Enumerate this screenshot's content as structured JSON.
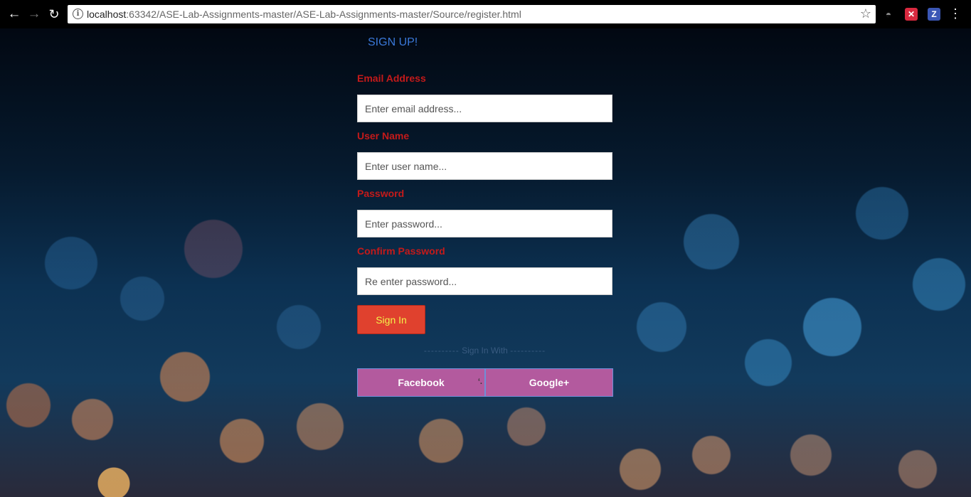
{
  "browser": {
    "url_host": "localhost",
    "url_rest": ":63342/ASE-Lab-Assignments-master/ASE-Lab-Assignments-master/Source/register.html",
    "icons": [
      "back-icon",
      "forward-icon",
      "reload-icon",
      "info-icon",
      "star-icon",
      "incognito-icon",
      "shield-icon",
      "z-icon",
      "menu-icon"
    ]
  },
  "icon_glyphs": {
    "back": "←",
    "forward": "→",
    "reload": "↻",
    "info": "i",
    "star": "☆",
    "spy": "◓",
    "shield": "✕",
    "z": "Z",
    "menu": "⋮",
    "cursor": "ʻ."
  },
  "form": {
    "title": "SIGN UP!",
    "email_label": "Email Address",
    "email_placeholder": "Enter email address...",
    "username_label": "User Name",
    "username_placeholder": "Enter user name...",
    "password_label": "Password",
    "password_placeholder": "Enter password...",
    "confirm_label": "Confirm Password",
    "confirm_placeholder": "Re enter password...",
    "signin_label": "Sign In",
    "divider_dashes_left": "----------",
    "divider_text": "Sign In With",
    "divider_dashes_right": "----------",
    "facebook_label": "Facebook",
    "google_label": "Google+"
  },
  "colors": {
    "title": "#3a78d8",
    "labels": "#c41a1a",
    "signin_bg": "#e0412e",
    "signin_text": "#f2f24a",
    "social_bg": "#b35a9e"
  }
}
